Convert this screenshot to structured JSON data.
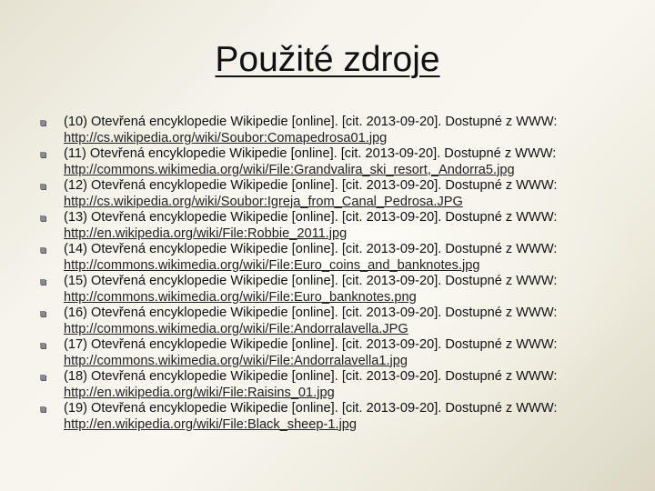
{
  "title": "Použité zdroje",
  "references": [
    {
      "text": "(10) Otevřená encyklopedie Wikipedie [online]. [cit. 2013-09-20]. Dostupné z WWW:",
      "url": "http://cs.wikipedia.org/wiki/Soubor:Comapedrosa01.jpg"
    },
    {
      "text": "(11) Otevřená encyklopedie Wikipedie [online]. [cit. 2013-09-20]. Dostupné z WWW:",
      "url": "http://commons.wikimedia.org/wiki/File:Grandvalira_ski_resort,_Andorra5.jpg"
    },
    {
      "text": "(12) Otevřená encyklopedie Wikipedie [online]. [cit. 2013-09-20]. Dostupné z WWW:",
      "url": "http://cs.wikipedia.org/wiki/Soubor:Igreja_from_Canal_Pedrosa.JPG"
    },
    {
      "text": "(13) Otevřená encyklopedie Wikipedie [online]. [cit. 2013-09-20]. Dostupné z WWW:",
      "url": "http://en.wikipedia.org/wiki/File:Robbie_2011.jpg"
    },
    {
      "text": "(14) Otevřená encyklopedie Wikipedie [online]. [cit. 2013-09-20]. Dostupné z WWW:",
      "url": "http://commons.wikimedia.org/wiki/File:Euro_coins_and_banknotes.jpg"
    },
    {
      "text": "(15) Otevřená encyklopedie Wikipedie [online]. [cit. 2013-09-20]. Dostupné z WWW:",
      "url": "http://commons.wikimedia.org/wiki/File:Euro_banknotes.png"
    },
    {
      "text": "(16) Otevřená encyklopedie Wikipedie [online]. [cit. 2013-09-20]. Dostupné z WWW:",
      "url": "http://commons.wikimedia.org/wiki/File:Andorralavella.JPG"
    },
    {
      "text": "(17) Otevřená encyklopedie Wikipedie [online]. [cit. 2013-09-20]. Dostupné z WWW:",
      "url": "http://commons.wikimedia.org/wiki/File:Andorralavella1.jpg"
    },
    {
      "text": "(18) Otevřená encyklopedie Wikipedie [online]. [cit. 2013-09-20]. Dostupné z WWW:",
      "url": "http://en.wikipedia.org/wiki/File:Raisins_01.jpg"
    },
    {
      "text": "(19) Otevřená encyklopedie Wikipedie [online]. [cit. 2013-09-20]. Dostupné z WWW:",
      "url": "http://en.wikipedia.org/wiki/File:Black_sheep-1.jpg"
    }
  ]
}
